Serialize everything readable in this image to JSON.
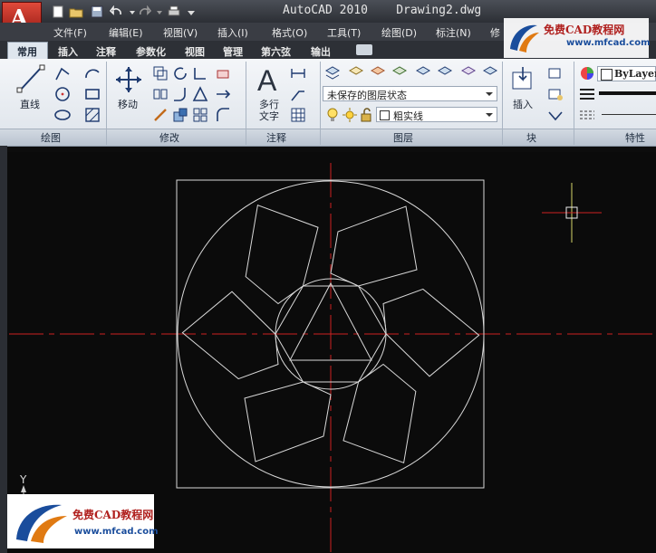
{
  "window": {
    "title": "AutoCAD 2010    Drawing2.dwg"
  },
  "menubar": {
    "items": [
      "文件(F)",
      "编辑(E)",
      "视图(V)",
      "插入(I)",
      "格式(O)",
      "工具(T)",
      "绘图(D)",
      "标注(N)",
      "修"
    ]
  },
  "ribbon_tabs": {
    "items": [
      "常用",
      "插入",
      "注释",
      "参数化",
      "视图",
      "管理",
      "第六弦",
      "输出"
    ],
    "active": "常用"
  },
  "panels": {
    "draw": {
      "title": "绘图",
      "line_label": "直线"
    },
    "modify": {
      "title": "修改",
      "move_label": "移动"
    },
    "annotation": {
      "title": "注释",
      "mtext_label_1": "多行",
      "mtext_label_2": "文字"
    },
    "layers": {
      "title": "图层",
      "layer_state": "未保存的图层状态",
      "current_layer": "粗实线"
    },
    "block": {
      "title": "块",
      "insert_label": "插入"
    },
    "properties": {
      "title": "特性",
      "color_value": "ByLayer"
    }
  },
  "ucs": {
    "y_label": "Y"
  },
  "watermark": {
    "name": "免费CAD教程网",
    "site": "www.mfcad.com"
  },
  "colors": {
    "accent_red": "#d42a1f",
    "crosshair": "#d4d46a",
    "centerline": "#cc2222",
    "geometry": "#d8d8d8"
  }
}
